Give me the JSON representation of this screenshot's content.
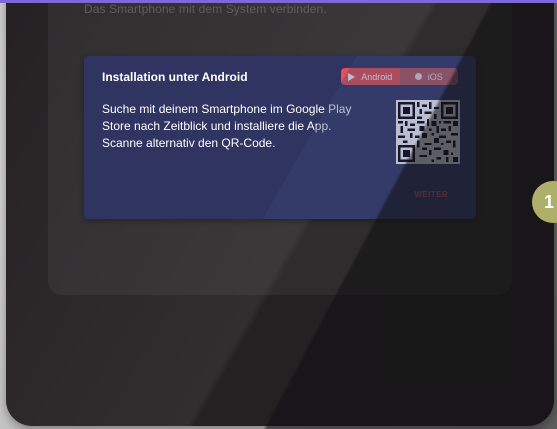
{
  "background_hint": "Das Smartphone mit dem System verbinden.",
  "panel": {
    "title": "Installation unter Android",
    "body": "Suche mit deinem Smartphone im Google Play Store nach Zeitblick und installiere die App. Scanne alternativ den QR-Code.",
    "next_label": "WEITER"
  },
  "toggle": {
    "android_label": "Android",
    "ios_label": "iOS",
    "selected": "Android"
  },
  "step": {
    "number": "1"
  },
  "icons": {
    "play": "play-icon",
    "dot": "dot-icon",
    "qr": "qr-code-icon"
  },
  "colors": {
    "accent": "#7b68d9",
    "panel_bg": "#2f3560",
    "toggle_active": "#e84f52",
    "next": "#e9564e",
    "badge": "#aeb06a"
  }
}
